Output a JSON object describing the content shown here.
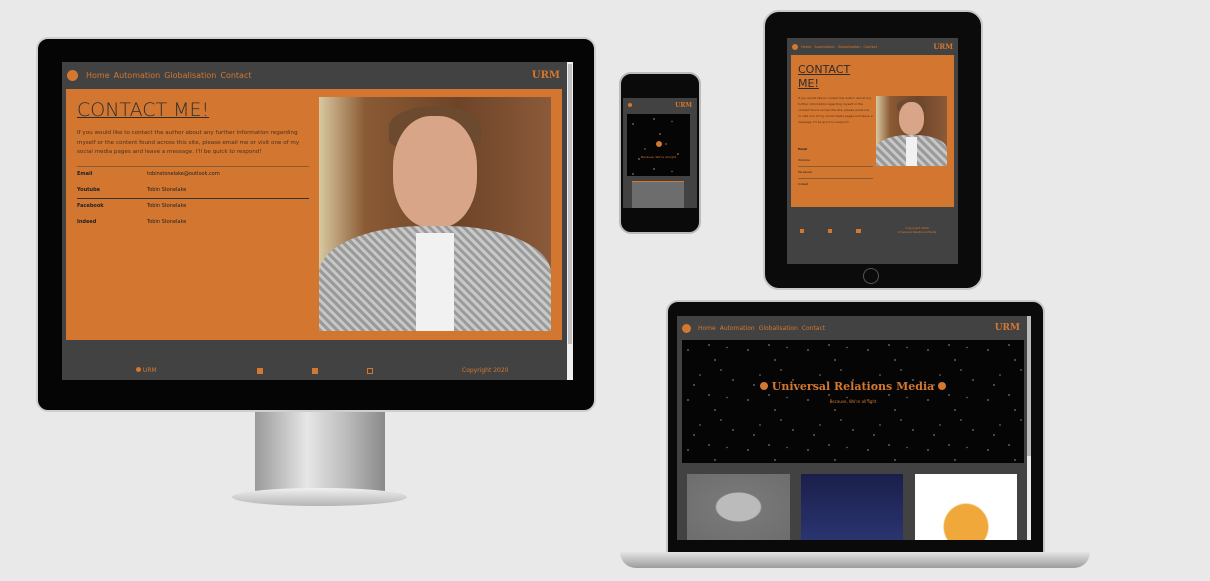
{
  "site": {
    "brand": "URM",
    "nav": [
      "Home",
      "Automation",
      "Globalisation",
      "Contact"
    ],
    "contact": {
      "title": "CONTACT ME!",
      "intro": "If you would like to contact the author about any further information regarding myself or the content found across this site, please email me or visit one of my social media pages and leave a message. I'll be quick to respond!",
      "rows": [
        {
          "label": "Email",
          "value": "tobinstonelake@outlook.com"
        },
        {
          "label": "Youtube",
          "value": "Tobin Stonelake"
        },
        {
          "label": "Facebook",
          "value": "Tobin Stonelake"
        },
        {
          "label": "Indeed",
          "value": "Tobin Stonelake"
        }
      ]
    },
    "footer": {
      "brand": "URM",
      "copyright": "Copyright 2020",
      "copyright_owner": "Universal Relations Media"
    },
    "hero": {
      "title": "Universal Relations Media",
      "subtitle": "Because, We're all light"
    }
  },
  "icons": [
    "globe-icon",
    "youtube-icon",
    "facebook-icon",
    "linkedin-icon"
  ],
  "colors": {
    "accent": "#d4772f",
    "nav": "#424242",
    "background": "#e9e9e9"
  }
}
